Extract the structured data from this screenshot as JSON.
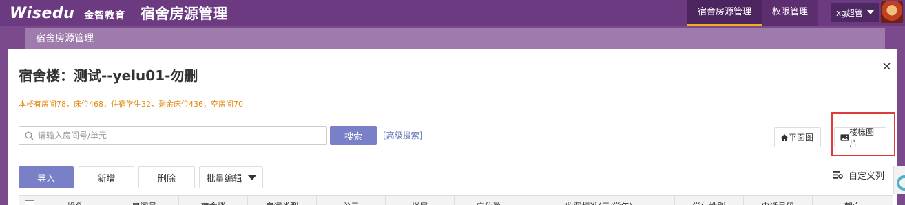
{
  "header": {
    "logo_en": "Wisedu",
    "logo_cn": "金智教育",
    "app_title": "宿舍房源管理",
    "nav": [
      "宿舍房源管理",
      "权限管理"
    ],
    "user": "xg超管"
  },
  "breadcrumb": "宿舍房源管理",
  "dialog": {
    "title": "宿舍楼：测试--yelu01-勿删",
    "stats": "本楼有房间78，床位468，住宿学生32，剩余床位436，空房间70",
    "close": "×",
    "search_placeholder": "请输入房间号/单元",
    "search_button": "搜索",
    "advanced_search": "[高级搜索]",
    "floor_plan": "平面图",
    "building_picture": "楼栋图片",
    "actions": [
      "导入",
      "新增",
      "删除",
      "批量编辑"
    ],
    "custom_columns": "自定义列",
    "table_headers": [
      "操作",
      "房间号",
      "宿舍楼",
      "房间类型",
      "单元",
      "楼层",
      "床位数",
      "收费标准(元/学年)",
      "学生性别",
      "电话号码",
      "朝向"
    ]
  },
  "colors": {
    "topbar": "#6b3a80",
    "accent": "#f5b020",
    "primary_button": "#7a80c8",
    "stats_text": "#e08a10",
    "highlight": "#e03a3a"
  }
}
